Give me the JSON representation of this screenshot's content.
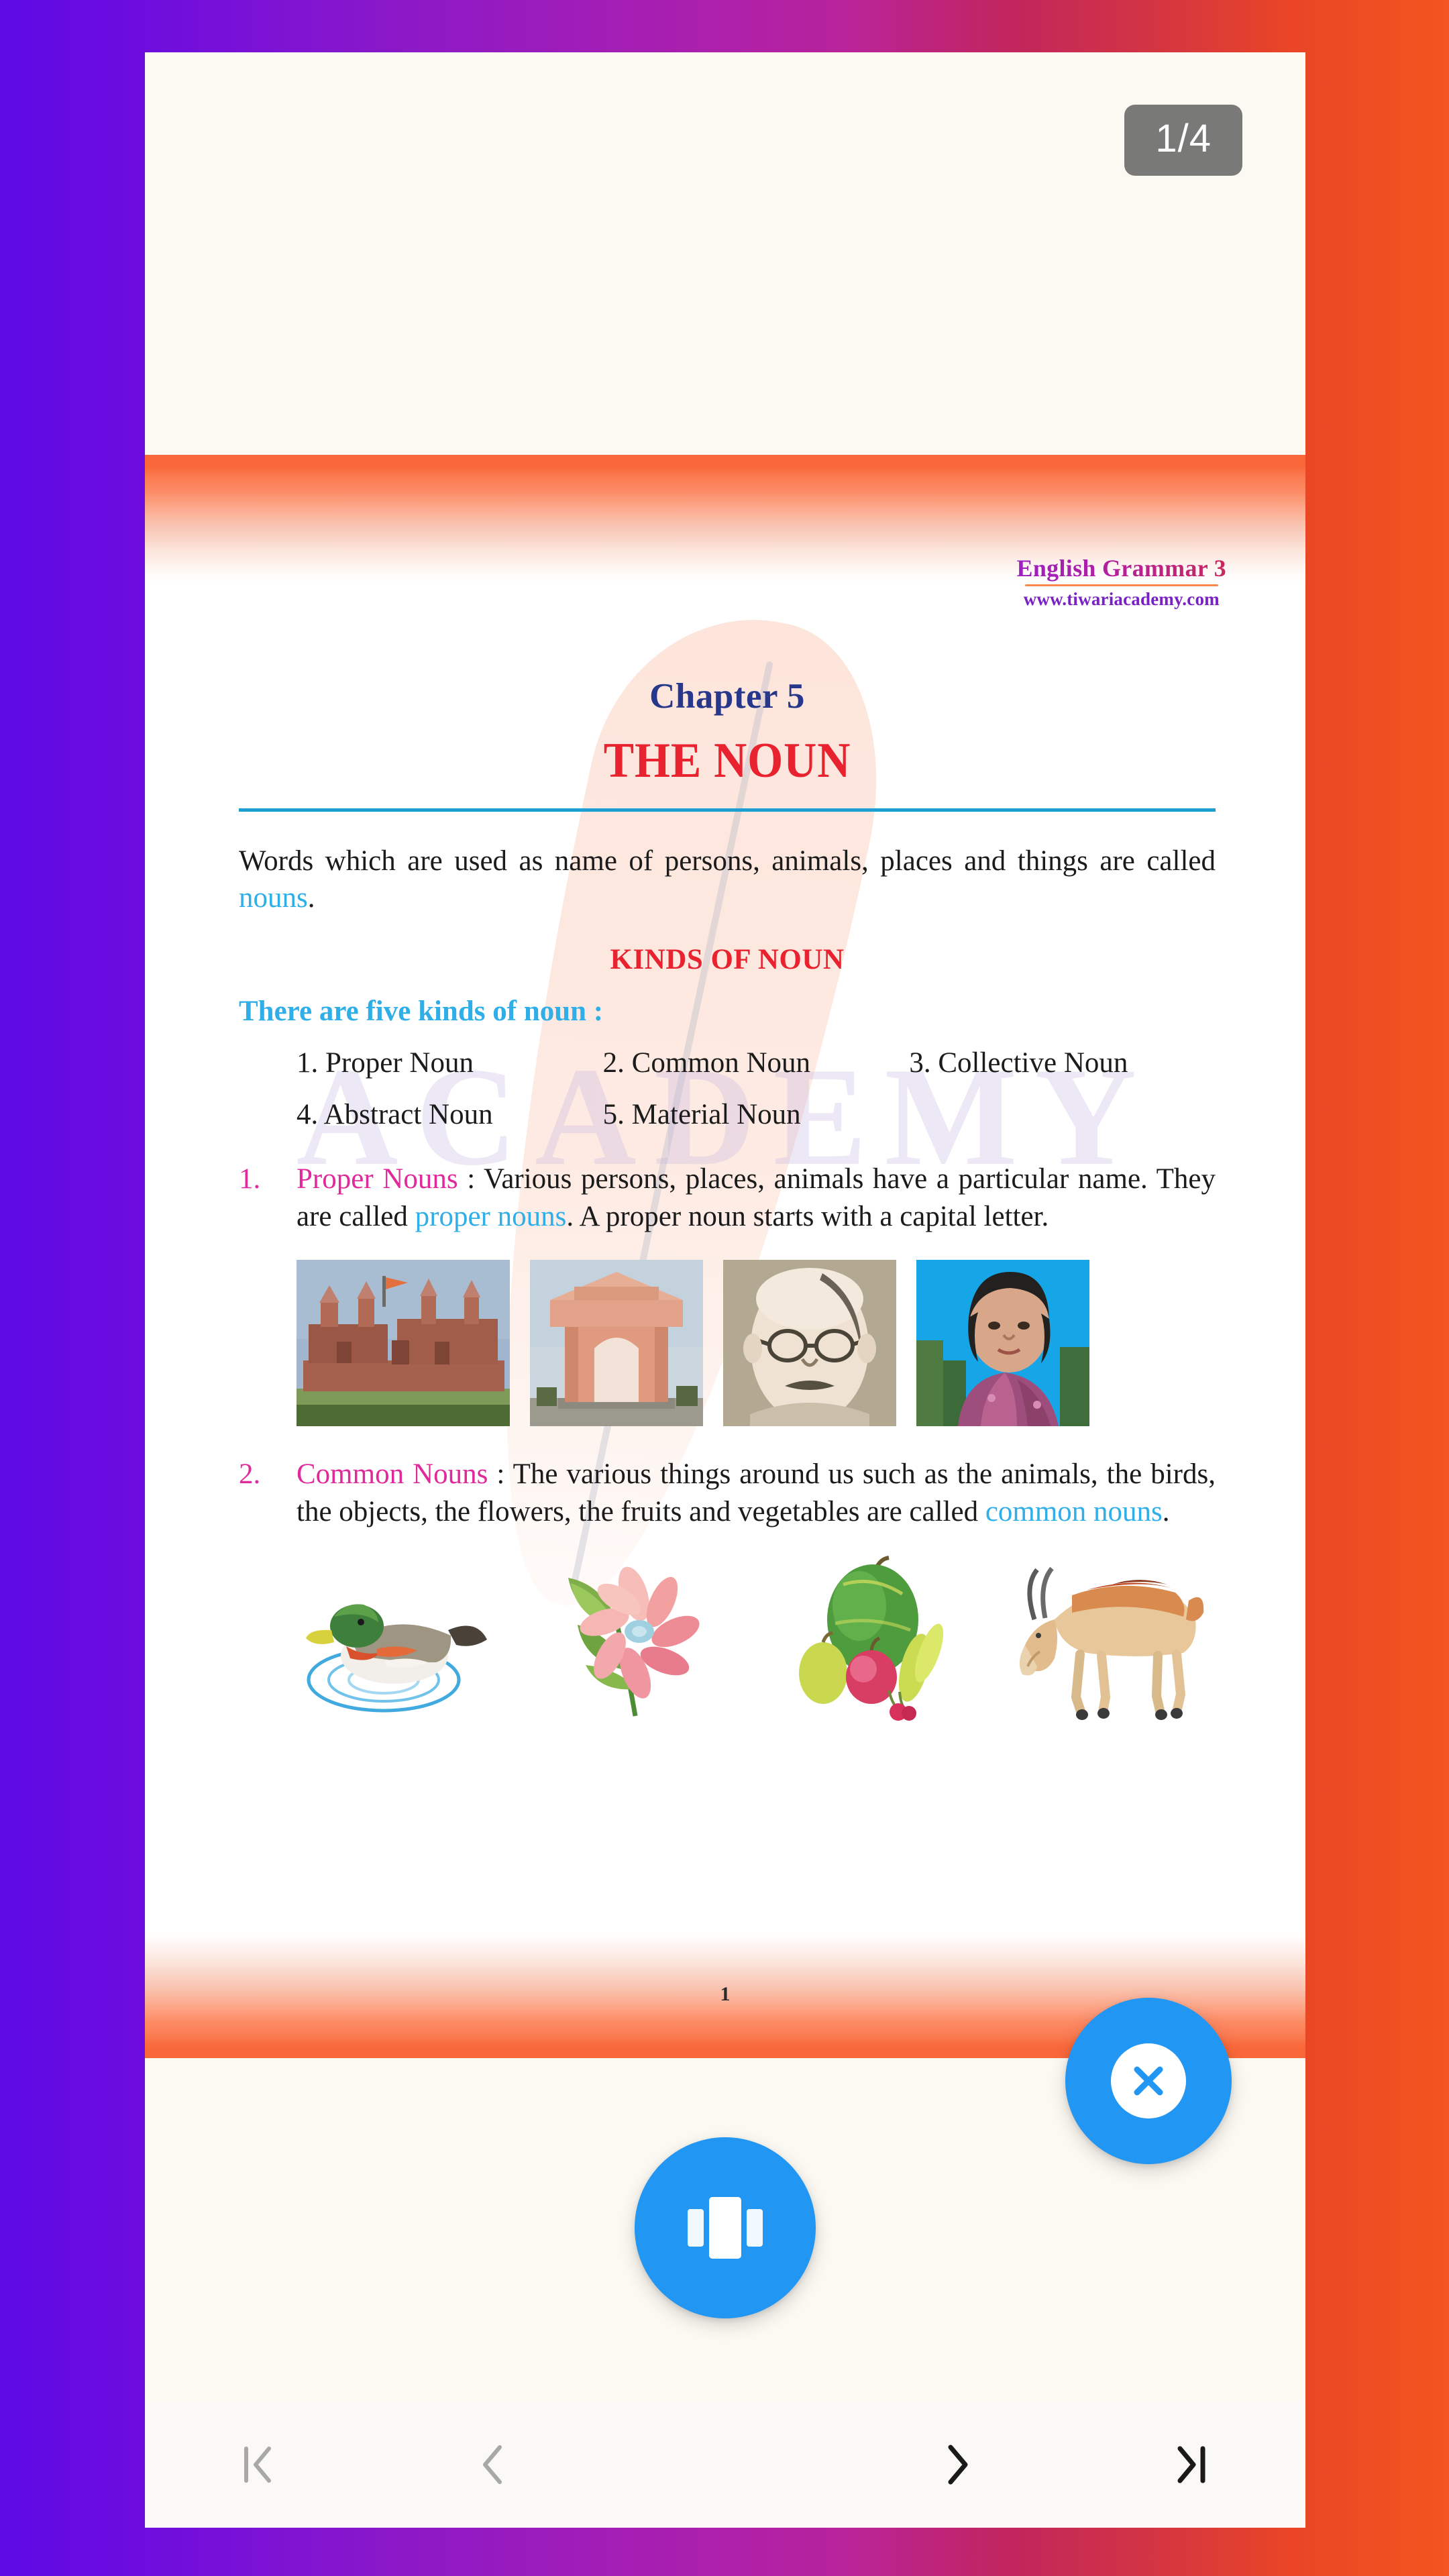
{
  "viewer": {
    "page_indicator": "1/4",
    "page_number_footer": "1"
  },
  "watermark": {
    "academy_text": "ACADEMY",
    "brand_title": "English Grammar 3",
    "brand_url": "www.tiwariacademy.com"
  },
  "document": {
    "chapter_label": "Chapter 5",
    "chapter_title": "THE NOUN",
    "intro": {
      "before": "Words which are used as name of persons, animals, places and things are called ",
      "highlight": "nouns",
      "after": "."
    },
    "kinds_heading": "KINDS OF NOUN",
    "kinds_intro": "There are five kinds of noun :",
    "kinds": [
      "1. Proper Noun",
      "2. Common Noun",
      "3. Collective Noun",
      "4. Abstract Noun",
      "5. Material Noun"
    ],
    "items": [
      {
        "number": "1.",
        "lead": "Proper Nouns",
        "text_1": " : Various persons, places, animals have a particular name. They are called ",
        "highlight": "proper nouns",
        "text_2": ". A proper noun starts with a capital letter.",
        "figures": [
          "red-fort-photo",
          "india-gate-photo",
          "gandhi-portrait-photo",
          "indira-gandhi-portrait-photo"
        ]
      },
      {
        "number": "2.",
        "lead": "Common Nouns",
        "text_1": " : The various things around us such as the animals, the birds, the objects, the flowers, the fruits and vegetables are called ",
        "highlight": "common nouns",
        "text_2": ".",
        "figures": [
          "duck-illustration",
          "flower-illustration",
          "fruits-illustration",
          "goat-illustration"
        ]
      }
    ]
  },
  "controls": {
    "close_label": "close-viewer",
    "mode_label": "view-mode",
    "nav": [
      {
        "name": "first-page",
        "enabled": false
      },
      {
        "name": "previous-page",
        "enabled": false
      },
      {
        "name": "next-page",
        "enabled": true
      },
      {
        "name": "last-page",
        "enabled": true
      }
    ]
  },
  "colors": {
    "accent_blue": "#2196F3",
    "title_red": "#E8232F",
    "chapter_navy": "#27388C",
    "cyan_highlight": "#2FAEE8",
    "magenta_highlight": "#E02A9B",
    "band_orange": "#F9683A",
    "rule_blue": "#1E9FD4"
  }
}
